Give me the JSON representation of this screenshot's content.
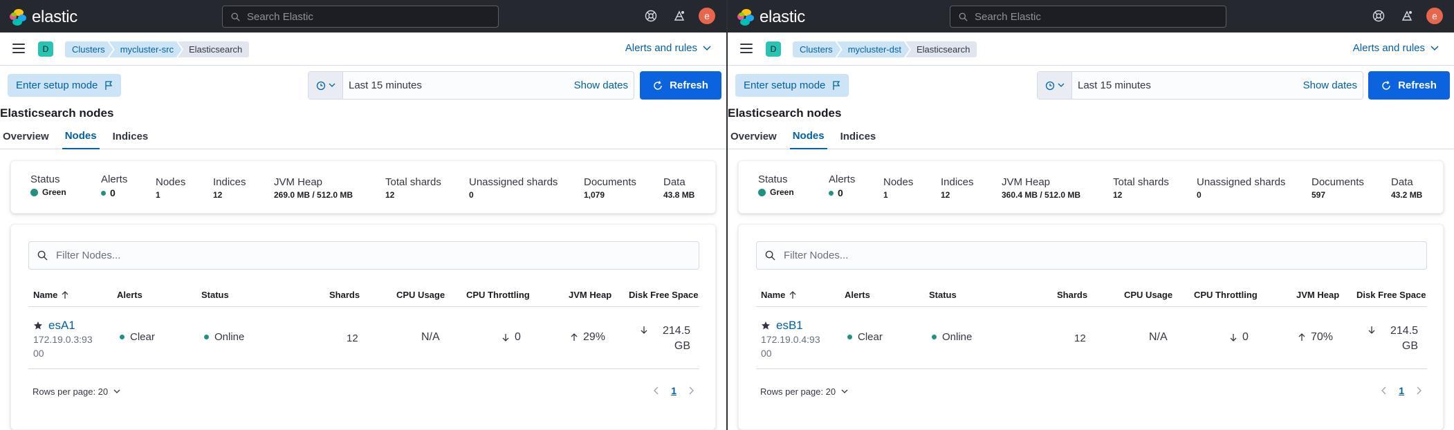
{
  "panes": [
    {
      "header": {
        "logo_text": "elastic",
        "search_placeholder": "Search Elastic",
        "avatar_initial": "e"
      },
      "breadcrumbs": {
        "space_initial": "D",
        "items": [
          "Clusters",
          "mycluster-src",
          "Elasticsearch"
        ],
        "alerts_menu": "Alerts and rules"
      },
      "toolbar": {
        "setup_mode": "Enter setup mode",
        "time_range": "Last 15 minutes",
        "show_dates": "Show dates",
        "refresh": "Refresh"
      },
      "page_title": "Elasticsearch nodes",
      "tabs": [
        "Overview",
        "Nodes",
        "Indices"
      ],
      "active_tab": "Nodes",
      "summary": {
        "status_label": "Status",
        "status_value": "Green",
        "alerts_label": "Alerts",
        "alerts_value": "0",
        "nodes_label": "Nodes",
        "nodes_value": "1",
        "indices_label": "Indices",
        "indices_value": "12",
        "jvm_label": "JVM Heap",
        "jvm_value": "269.0 MB / 512.0 MB",
        "shards_label": "Total shards",
        "shards_value": "12",
        "unassigned_label": "Unassigned shards",
        "unassigned_value": "0",
        "documents_label": "Documents",
        "documents_value": "1,079",
        "data_label": "Data",
        "data_value": "43.8 MB"
      },
      "table": {
        "filter_placeholder": "Filter Nodes...",
        "columns": [
          "Name",
          "Alerts",
          "Status",
          "Shards",
          "CPU Usage",
          "CPU Throttling",
          "JVM Heap",
          "Disk Free Space"
        ],
        "row": {
          "name": "esA1",
          "address_line1": "172.19.0.3:93",
          "address_line2": "00",
          "alerts": "Clear",
          "status": "Online",
          "shards": "12",
          "cpu_usage": "N/A",
          "cpu_throttling": "0",
          "jvm_heap": "29%",
          "disk_line1": "214.5",
          "disk_line2": "GB"
        },
        "rows_per_page": "Rows per page: 20",
        "page": "1"
      }
    },
    {
      "header": {
        "logo_text": "elastic",
        "search_placeholder": "Search Elastic",
        "avatar_initial": "e"
      },
      "breadcrumbs": {
        "space_initial": "D",
        "items": [
          "Clusters",
          "mycluster-dst",
          "Elasticsearch"
        ],
        "alerts_menu": "Alerts and rules"
      },
      "toolbar": {
        "setup_mode": "Enter setup mode",
        "time_range": "Last 15 minutes",
        "show_dates": "Show dates",
        "refresh": "Refresh"
      },
      "page_title": "Elasticsearch nodes",
      "tabs": [
        "Overview",
        "Nodes",
        "Indices"
      ],
      "active_tab": "Nodes",
      "summary": {
        "status_label": "Status",
        "status_value": "Green",
        "alerts_label": "Alerts",
        "alerts_value": "0",
        "nodes_label": "Nodes",
        "nodes_value": "1",
        "indices_label": "Indices",
        "indices_value": "12",
        "jvm_label": "JVM Heap",
        "jvm_value": "360.4 MB / 512.0 MB",
        "shards_label": "Total shards",
        "shards_value": "12",
        "unassigned_label": "Unassigned shards",
        "unassigned_value": "0",
        "documents_label": "Documents",
        "documents_value": "597",
        "data_label": "Data",
        "data_value": "43.2 MB"
      },
      "table": {
        "filter_placeholder": "Filter Nodes...",
        "columns": [
          "Name",
          "Alerts",
          "Status",
          "Shards",
          "CPU Usage",
          "CPU Throttling",
          "JVM Heap",
          "Disk Free Space"
        ],
        "row": {
          "name": "esB1",
          "address_line1": "172.19.0.4:93",
          "address_line2": "00",
          "alerts": "Clear",
          "status": "Online",
          "shards": "12",
          "cpu_usage": "N/A",
          "cpu_throttling": "0",
          "jvm_heap": "70%",
          "disk_line1": "214.5",
          "disk_line2": "GB"
        },
        "rows_per_page": "Rows per page: 20",
        "page": "1"
      }
    }
  ],
  "colors": {
    "header_bg": "#25282f",
    "link_blue": "#0061a6",
    "primary_button": "#0b64dd",
    "status_green": "#209280",
    "avatar_orange": "#e7664c",
    "space_badge": "#28c4b3"
  },
  "icons": [
    "elastic-logo-icon",
    "search-icon",
    "help-icon",
    "news-icon",
    "hamburger-icon",
    "chevron-down-icon",
    "flag-icon",
    "calendar-icon",
    "refresh-icon",
    "star-icon",
    "arrow-up-icon",
    "arrow-down-icon",
    "chevron-left-icon",
    "chevron-right-icon"
  ]
}
